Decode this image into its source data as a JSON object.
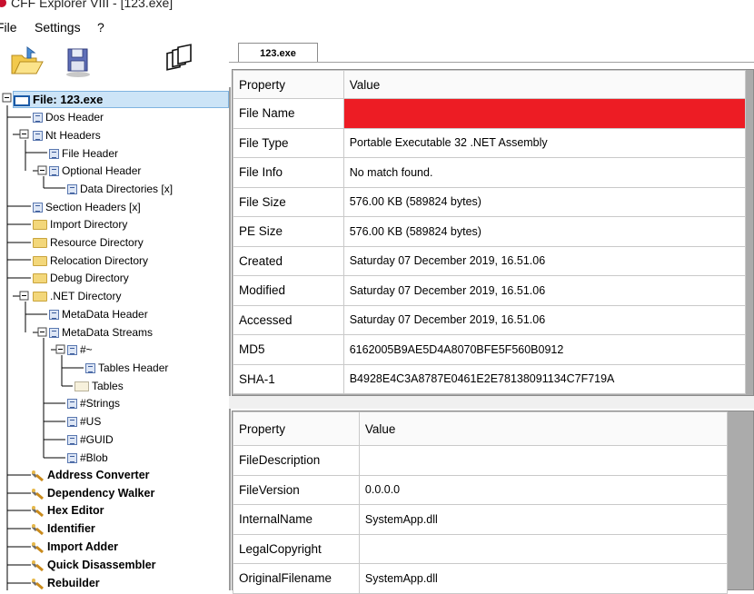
{
  "window": {
    "title": "CFF Explorer VIII - [123.exe]"
  },
  "menubar": {
    "items": [
      {
        "label": "File"
      },
      {
        "label": "Settings"
      },
      {
        "label": "?"
      }
    ]
  },
  "toolbar": {
    "buttons": [
      {
        "icon": "open-folder-icon"
      },
      {
        "icon": "save-icon"
      },
      {
        "icon": "windows-icon"
      }
    ]
  },
  "tree": {
    "items": [
      {
        "label": "File: 123.exe",
        "icon": "file-icon"
      },
      {
        "label": "Dos Header",
        "icon": "doc-icon"
      },
      {
        "label": "Nt Headers",
        "icon": "doc-icon"
      },
      {
        "label": "File Header",
        "icon": "doc-icon"
      },
      {
        "label": "Optional Header",
        "icon": "doc-icon"
      },
      {
        "label": "Data Directories [x]",
        "icon": "doc-icon"
      },
      {
        "label": "Section Headers [x]",
        "icon": "doc-icon"
      },
      {
        "label": "Import Directory",
        "icon": "folder-icon"
      },
      {
        "label": "Resource Directory",
        "icon": "folder-icon"
      },
      {
        "label": "Relocation Directory",
        "icon": "folder-icon"
      },
      {
        "label": "Debug Directory",
        "icon": "folder-icon"
      },
      {
        "label": ".NET Directory",
        "icon": "folder-icon"
      },
      {
        "label": "MetaData Header",
        "icon": "doc-icon"
      },
      {
        "label": "MetaData Streams",
        "icon": "doc-icon"
      },
      {
        "label": "#~",
        "icon": "doc-icon"
      },
      {
        "label": "Tables Header",
        "icon": "doc-icon"
      },
      {
        "label": "Tables",
        "icon": "folder-open-icon"
      },
      {
        "label": "#Strings",
        "icon": "doc-icon"
      },
      {
        "label": "#US",
        "icon": "doc-icon"
      },
      {
        "label": "#GUID",
        "icon": "doc-icon"
      },
      {
        "label": "#Blob",
        "icon": "doc-icon"
      },
      {
        "label": "Address Converter",
        "icon": "tool-icon"
      },
      {
        "label": "Dependency Walker",
        "icon": "tool-icon"
      },
      {
        "label": "Hex Editor",
        "icon": "tool-icon"
      },
      {
        "label": "Identifier",
        "icon": "tool-icon"
      },
      {
        "label": "Import Adder",
        "icon": "tool-icon"
      },
      {
        "label": "Quick Disassembler",
        "icon": "tool-icon"
      },
      {
        "label": "Rebuilder",
        "icon": "tool-icon"
      }
    ]
  },
  "tab": {
    "label": "123.exe"
  },
  "file_props": {
    "headers": [
      "Property",
      "Value"
    ],
    "rows": [
      [
        "File Name",
        ""
      ],
      [
        "File Type",
        "Portable Executable 32 .NET Assembly"
      ],
      [
        "File Info",
        "No match found."
      ],
      [
        "File Size",
        "576.00 KB (589824 bytes)"
      ],
      [
        "PE Size",
        "576.00 KB (589824 bytes)"
      ],
      [
        "Created",
        "Saturday 07 December 2019, 16.51.06"
      ],
      [
        "Modified",
        "Saturday 07 December 2019, 16.51.06"
      ],
      [
        "Accessed",
        "Saturday 07 December 2019, 16.51.06"
      ],
      [
        "MD5",
        "6162005B9AE5D4A8070BFE5F560B0912"
      ],
      [
        "SHA-1",
        "B4928E4C3A8787E0461E2E78138091134C7F719A"
      ]
    ]
  },
  "version_props": {
    "headers": [
      "Property",
      "Value"
    ],
    "rows": [
      [
        "FileDescription",
        ""
      ],
      [
        "FileVersion",
        "0.0.0.0"
      ],
      [
        "InternalName",
        "SystemApp.dll"
      ],
      [
        "LegalCopyright",
        ""
      ],
      [
        "OriginalFilename",
        "SystemApp.dll"
      ]
    ]
  },
  "colors": {
    "redaction": "#ed1c24",
    "selection": "#cce4f7",
    "grid_background": "#ababab"
  }
}
